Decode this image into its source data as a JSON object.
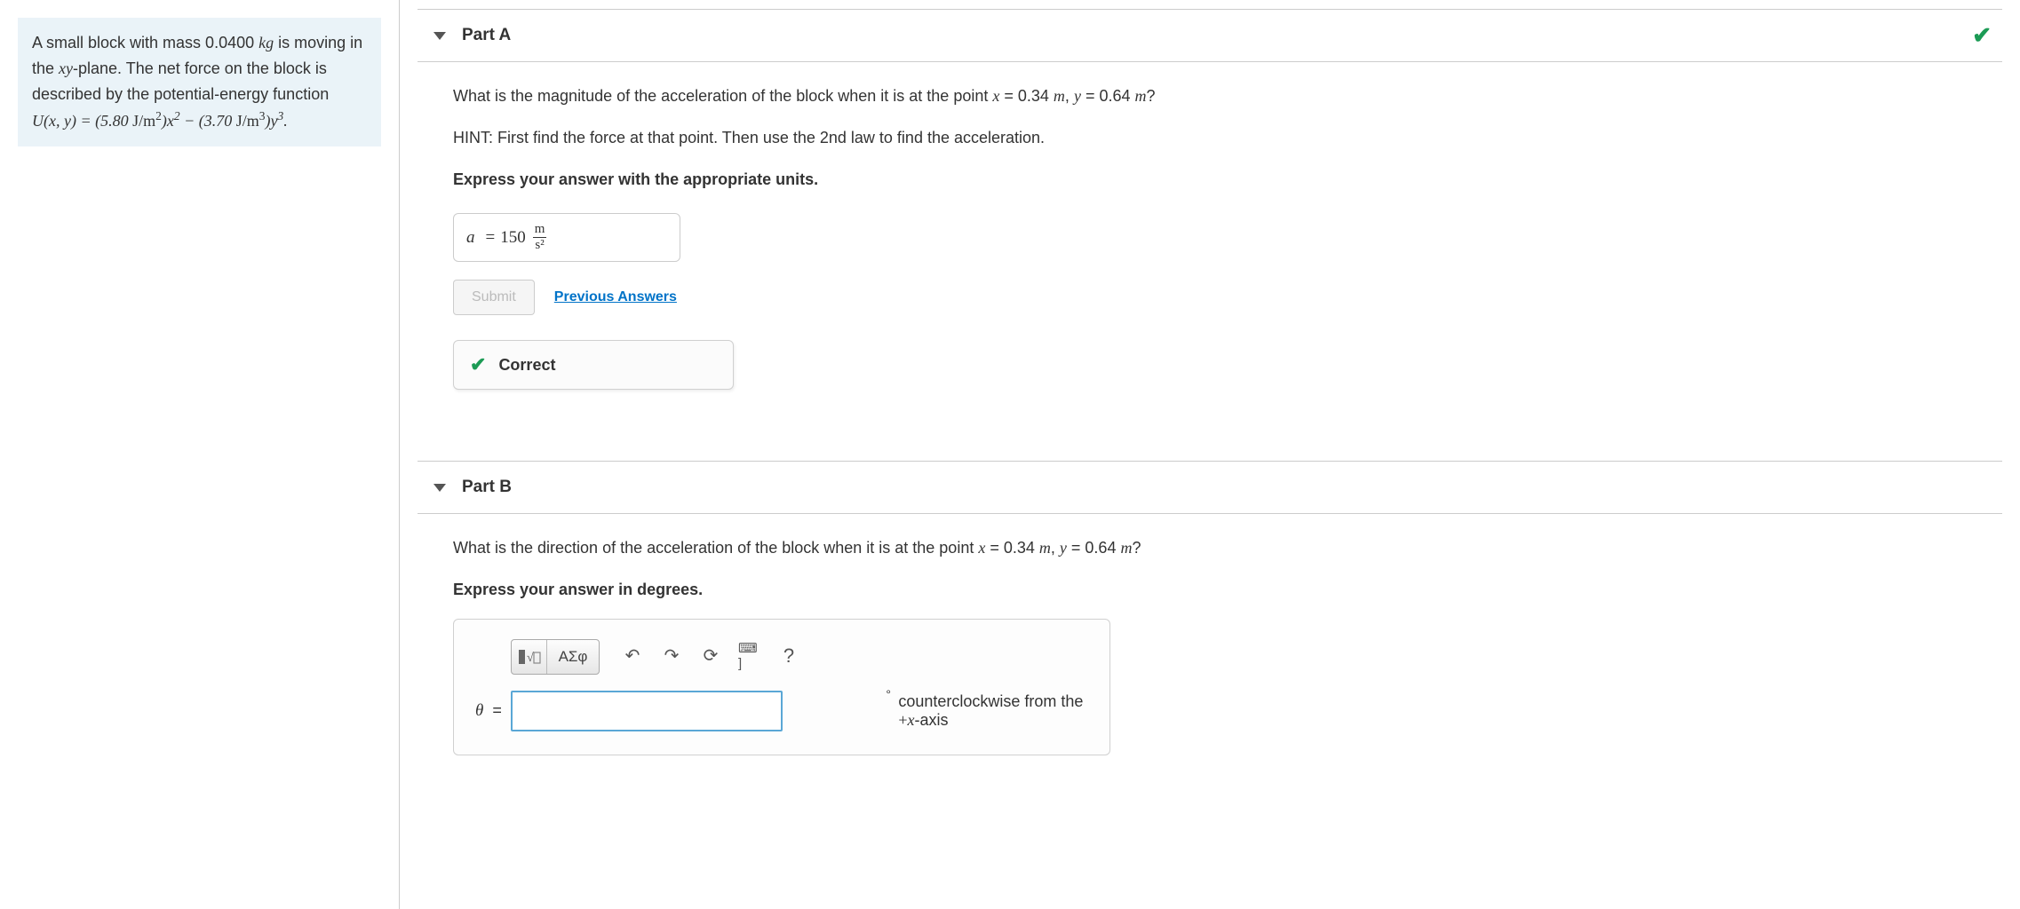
{
  "problem": {
    "intro": "A small block with mass 0.0400 kg is moving in the xy-plane. The net force on the block is described by the potential-energy function",
    "equation": "U(x, y) = (5.80 J/m²)x² − (3.70 J/m³)y³."
  },
  "partA": {
    "title": "Part A",
    "question": "What is the magnitude  of the acceleration of the block when it is at the point x = 0.34 m, y = 0.64 m?",
    "hint": "HINT: First find the force at that point. Then use the 2nd law to find the acceleration.",
    "express": "Express your answer with the appropriate units.",
    "answer_var": "a",
    "answer_eq": "=",
    "answer_value": "150",
    "answer_unit_num": "m",
    "answer_unit_den": "s²",
    "submit_label": "Submit",
    "previous_label": "Previous Answers",
    "correct_label": "Correct"
  },
  "partB": {
    "title": "Part B",
    "question": "What is the direction of the acceleration of the block when it is at the point x = 0.34 m, y = 0.64 m?",
    "express": "Express your answer in degrees.",
    "theta_label": "θ",
    "theta_eq": "=",
    "suffix_text": "counterclockwise from the +x-axis",
    "toolbar": {
      "templates": "▮√▯",
      "greek": "ΑΣφ",
      "undo": "↶",
      "redo": "↷",
      "reset": "⟳",
      "keyboard": "⌨ ]",
      "help": "?"
    }
  }
}
